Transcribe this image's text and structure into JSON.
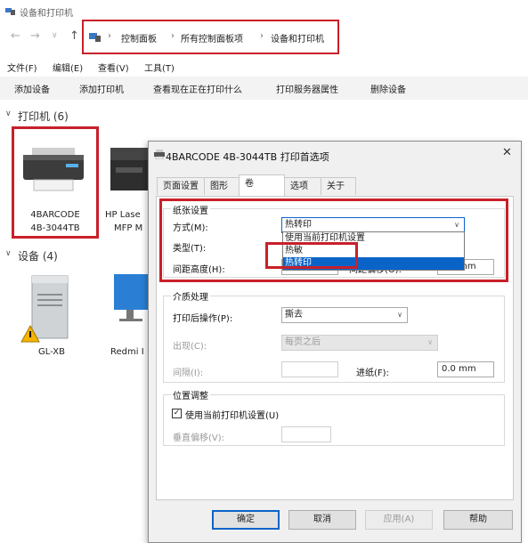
{
  "window": {
    "title": "设备和打印机"
  },
  "nav": {
    "back": "←",
    "forward": "→",
    "down": "∨",
    "up": "↑",
    "breadcrumb": [
      "控制面板",
      "所有控制面板项",
      "设备和打印机"
    ],
    "sep": "›"
  },
  "menubar": [
    "文件(F)",
    "编辑(E)",
    "查看(V)",
    "工具(T)"
  ],
  "toolbar": [
    "添加设备",
    "添加打印机",
    "查看现在正在打印什么",
    "打印服务器属性",
    "删除设备"
  ],
  "printers_group": {
    "label": "打印机 (6)",
    "items": [
      {
        "name_line1": "4BARCODE",
        "name_line2": "4B-3044TB"
      },
      {
        "name_line1": "HP Lase",
        "name_line2": "MFP M"
      }
    ]
  },
  "devices_group": {
    "label": "设备 (4)",
    "items": [
      {
        "name": "GL-XB"
      },
      {
        "name": "Redmi I"
      }
    ]
  },
  "dialog": {
    "title": "4BARCODE 4B-3044TB 打印首选项",
    "close": "✕",
    "tabs": [
      "页面设置",
      "图形",
      "卷",
      "选项",
      "关于"
    ],
    "paper": {
      "legend": "纸张设置",
      "method_label": "方式(M):",
      "method_value": "热转印",
      "type_label": "类型(T):",
      "gap_label": "间距高度(H):",
      "offset_label": "间距偏移(O):",
      "offset_value": "0.0 mm",
      "dropdown_options": [
        "使用当前打印机设置",
        "热敏",
        "热转印"
      ]
    },
    "media": {
      "legend": "介质处理",
      "after_label": "打印后操作(P):",
      "after_value": "撕去",
      "occur_label": "出现(C):",
      "occur_value": "每页之后",
      "interval_label": "间隔(I):",
      "interval_value": "",
      "feed_label": "进纸(F):",
      "feed_value": "0.0 mm"
    },
    "position": {
      "legend": "位置调整",
      "use_current_label": "使用当前打印机设置(U)",
      "checked": true,
      "vertical_label": "垂直偏移(V):",
      "vertical_value": ""
    },
    "buttons": {
      "ok": "确定",
      "cancel": "取消",
      "apply": "应用(A)",
      "help": "帮助"
    }
  },
  "colors": {
    "highlight_red": "#c8202a",
    "selection_blue": "#0a64c8"
  }
}
